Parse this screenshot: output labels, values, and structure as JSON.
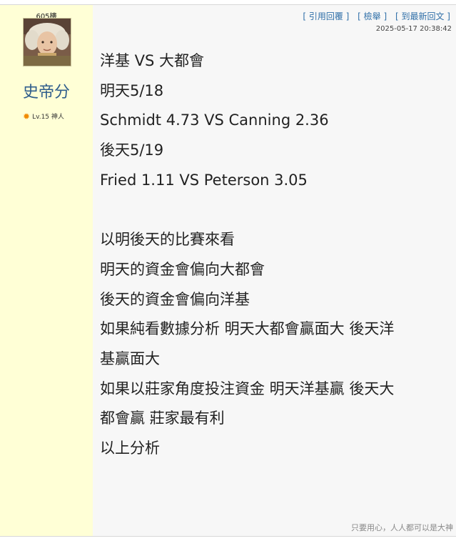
{
  "post": {
    "floor": "605樓",
    "username": "史帝分",
    "level": "Lv.15 神人",
    "actions": {
      "reply": "[ 引用回覆 ]",
      "report": "[ 檢舉 ]",
      "latest": "[ 到最新回文 ]"
    },
    "timestamp": "2025-05-17 20:38:42",
    "lines": [
      "洋基 VS 大都會",
      "明天5/18",
      "Schmidt 4.73  VS  Canning 2.36",
      "後天5/19",
      "Fried 1.11  VS  Peterson 3.05",
      "",
      "以明後天的比賽來看",
      "明天的資金會偏向大都會",
      "後天的資金會偏向洋基",
      "如果純看數據分析 明天大都會贏面大  後天洋",
      "基贏面大",
      "如果以莊家角度投注資金  明天洋基贏  後天大",
      "都會贏 莊家最有利",
      "以上分析"
    ],
    "signature": "只要用心，人人都可以是大神"
  }
}
